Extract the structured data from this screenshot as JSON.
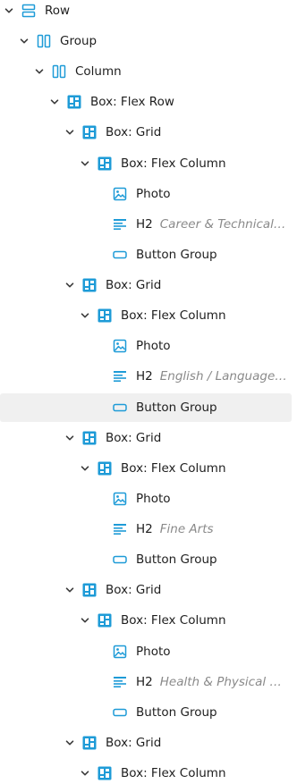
{
  "accent_color": "#1e9bd7",
  "tree": [
    {
      "depth": 0,
      "icon": "row-icon",
      "label": "Row",
      "expandable": true
    },
    {
      "depth": 1,
      "icon": "group-icon",
      "label": "Group",
      "expandable": true
    },
    {
      "depth": 2,
      "icon": "group-icon",
      "label": "Column",
      "expandable": true
    },
    {
      "depth": 3,
      "icon": "box-icon",
      "label": "Box: Flex Row",
      "expandable": true
    },
    {
      "depth": 4,
      "icon": "box-icon",
      "label": "Box: Grid",
      "expandable": true
    },
    {
      "depth": 5,
      "icon": "box-icon",
      "label": "Box: Flex Column",
      "expandable": true
    },
    {
      "depth": 6,
      "icon": "image-icon",
      "label": "Photo",
      "expandable": false
    },
    {
      "depth": 6,
      "icon": "heading-icon",
      "label": "H2",
      "sub": "Career & Technical Edu...",
      "expandable": false
    },
    {
      "depth": 6,
      "icon": "button-icon",
      "label": "Button Group",
      "expandable": false
    },
    {
      "depth": 4,
      "icon": "box-icon",
      "label": "Box: Grid",
      "expandable": true
    },
    {
      "depth": 5,
      "icon": "box-icon",
      "label": "Box: Flex Column",
      "expandable": true
    },
    {
      "depth": 6,
      "icon": "image-icon",
      "label": "Photo",
      "expandable": false
    },
    {
      "depth": 6,
      "icon": "heading-icon",
      "label": "H2",
      "sub": "English / Language Arts",
      "expandable": false
    },
    {
      "depth": 6,
      "icon": "button-icon",
      "label": "Button Group",
      "expandable": false,
      "selected": true
    },
    {
      "depth": 4,
      "icon": "box-icon",
      "label": "Box: Grid",
      "expandable": true
    },
    {
      "depth": 5,
      "icon": "box-icon",
      "label": "Box: Flex Column",
      "expandable": true
    },
    {
      "depth": 6,
      "icon": "image-icon",
      "label": "Photo",
      "expandable": false
    },
    {
      "depth": 6,
      "icon": "heading-icon",
      "label": "H2",
      "sub": "Fine Arts",
      "expandable": false
    },
    {
      "depth": 6,
      "icon": "button-icon",
      "label": "Button Group",
      "expandable": false
    },
    {
      "depth": 4,
      "icon": "box-icon",
      "label": "Box: Grid",
      "expandable": true
    },
    {
      "depth": 5,
      "icon": "box-icon",
      "label": "Box: Flex Column",
      "expandable": true
    },
    {
      "depth": 6,
      "icon": "image-icon",
      "label": "Photo",
      "expandable": false
    },
    {
      "depth": 6,
      "icon": "heading-icon",
      "label": "H2",
      "sub": "Health & Physical Educ...",
      "expandable": false
    },
    {
      "depth": 6,
      "icon": "button-icon",
      "label": "Button Group",
      "expandable": false
    },
    {
      "depth": 4,
      "icon": "box-icon",
      "label": "Box: Grid",
      "expandable": true
    },
    {
      "depth": 5,
      "icon": "box-icon",
      "label": "Box: Flex Column",
      "expandable": true
    }
  ]
}
